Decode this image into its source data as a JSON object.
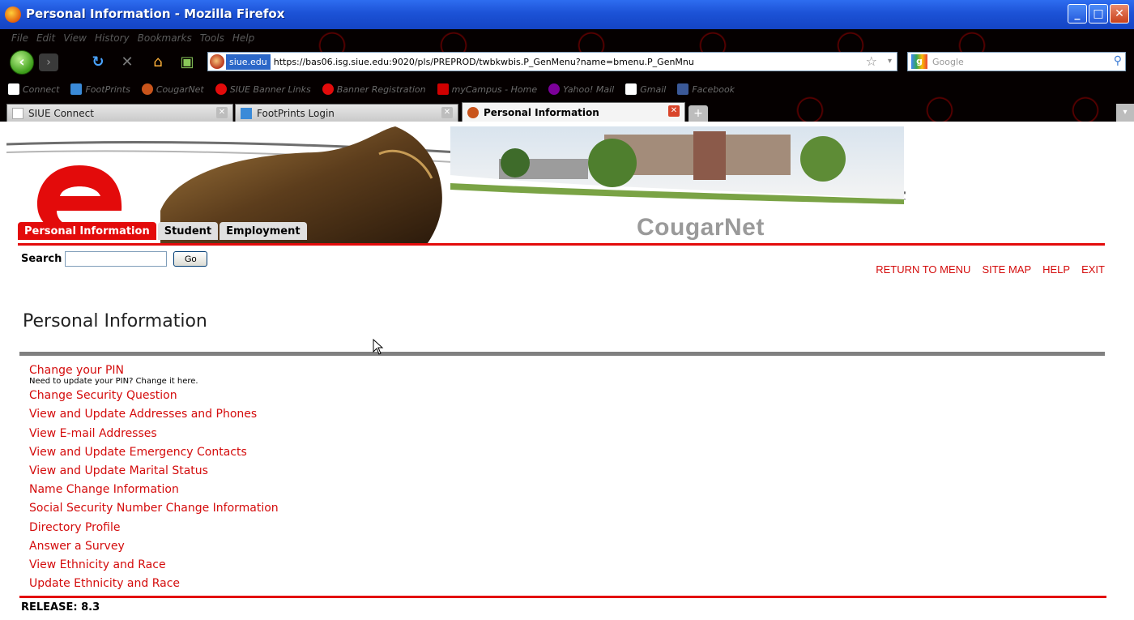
{
  "window": {
    "title": "Personal Information - Mozilla Firefox",
    "min_glyph": "_",
    "max_glyph": "□",
    "close_glyph": "✕"
  },
  "menubar": [
    "File",
    "Edit",
    "View",
    "History",
    "Bookmarks",
    "Tools",
    "Help"
  ],
  "navbar": {
    "back_glyph": "‹",
    "forward_glyph": "›",
    "reload_glyph": "↻",
    "stop_glyph": "✕",
    "home_glyph": "⌂",
    "history_glyph": "▣",
    "url_domain": "siue.edu",
    "url": "https://bas06.isg.siue.edu:9020/pls/PREPROD/twbkwbis.P_GenMenu?name=bmenu.P_GenMnu",
    "star_glyph": "☆",
    "dropdown_glyph": "▾",
    "search_engine_glyph": "g",
    "search_placeholder": "Google",
    "search_glyph": "⚲"
  },
  "bookmarks": [
    {
      "label": "Connect",
      "color": "#ffffff"
    },
    {
      "label": "FootPrints",
      "color": "#3a8ad8"
    },
    {
      "label": "CougarNet",
      "color": "#c9541b"
    },
    {
      "label": "SIUE Banner Links",
      "color": "#e30b0b"
    },
    {
      "label": "Banner Registration",
      "color": "#e30b0b"
    },
    {
      "label": "myCampus - Home",
      "color": "#d00000"
    },
    {
      "label": "Yahoo! Mail",
      "color": "#7b0099"
    },
    {
      "label": "Gmail",
      "color": "#ffffff"
    },
    {
      "label": "Facebook",
      "color": "#3b5998"
    }
  ],
  "tabs": [
    {
      "label": "SIUE Connect"
    },
    {
      "label": "FootPrints Login"
    },
    {
      "label": "Personal Information"
    }
  ],
  "tab_close_glyph": "✕",
  "tab_new_glyph": "+",
  "tab_list_glyph": "▾",
  "banner": {
    "site_name": "CougarNet",
    "tabs": [
      "Personal Information",
      "Student",
      "Employment"
    ]
  },
  "search": {
    "label": "Search",
    "value": "",
    "button": "Go"
  },
  "toplinks": [
    "RETURN TO MENU",
    "SITE MAP",
    "HELP",
    "EXIT"
  ],
  "page_title": "Personal Information",
  "menu": [
    {
      "label": "Change your PIN",
      "desc": "Need to update your PIN? Change it here."
    },
    {
      "label": "Change Security Question"
    },
    {
      "label": "View and Update Addresses and Phones"
    },
    {
      "label": "View E-mail Addresses"
    },
    {
      "label": "View and Update Emergency Contacts"
    },
    {
      "label": "View and Update Marital Status"
    },
    {
      "label": "Name Change Information"
    },
    {
      "label": "Social Security Number Change Information"
    },
    {
      "label": "Directory Profile"
    },
    {
      "label": "Answer a Survey"
    },
    {
      "label": "View Ethnicity and Race"
    },
    {
      "label": "Update Ethnicity and Race"
    }
  ],
  "release": "RELEASE: 8.3",
  "colors": {
    "accent_red": "#e30b0b",
    "link_red": "#d40c0c",
    "rule_gray": "#808080",
    "titlebar_blue": "#1c52d6"
  }
}
